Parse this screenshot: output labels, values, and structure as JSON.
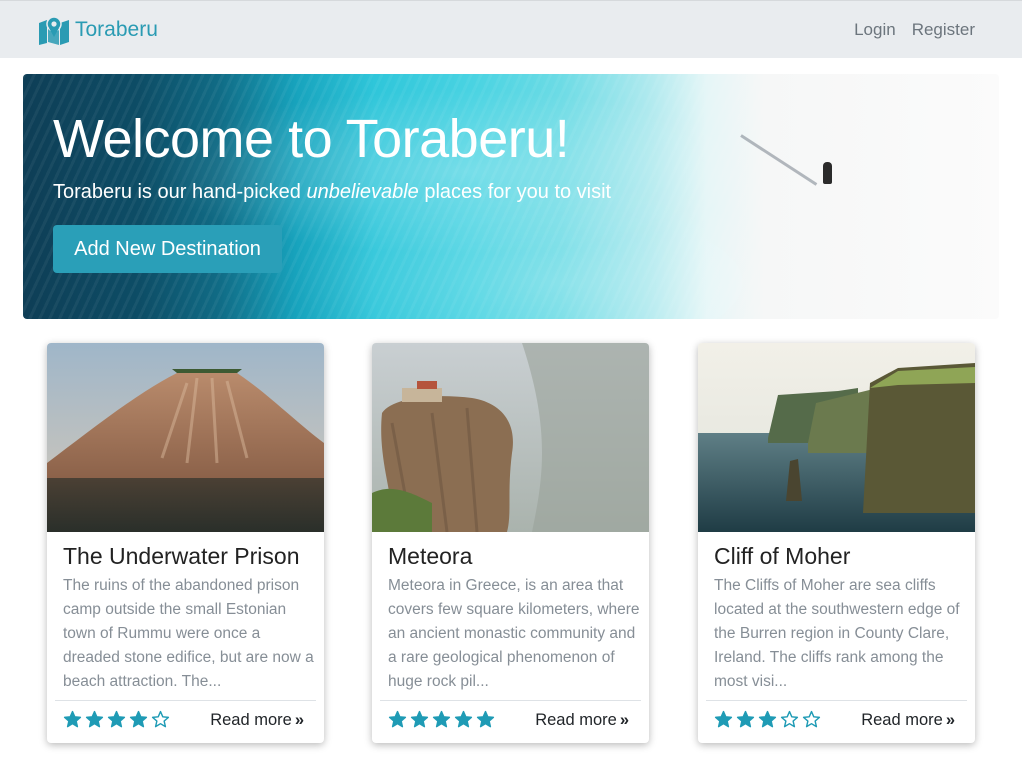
{
  "navbar": {
    "brand": "Toraberu",
    "brand_icon": "map-marker-icon",
    "links": [
      "Login",
      "Register"
    ]
  },
  "hero": {
    "title": "Welcome to Toraberu!",
    "lead_prefix": "Toraberu is our hand-picked ",
    "lead_emphasis": "unbelievable",
    "lead_suffix": " places for you to visit",
    "button": "Add New Destination"
  },
  "cards": [
    {
      "title": "The Underwater Prison",
      "text": "The ruins of the abandoned prison camp outside the small Estonian town of Rummu were once a dreaded stone edifice, but are now a beach attraction. The...",
      "rating": 4,
      "read_more": "Read more"
    },
    {
      "title": "Meteora",
      "text": "Meteora in Greece, is an area that covers few square kilometers, where an ancient monastic community and a rare geological phenomenon of huge rock pil...",
      "rating": 5,
      "read_more": "Read more"
    },
    {
      "title": "Cliff of Moher",
      "text": "The Cliffs of Moher are sea cliffs located at the southwestern edge of the Burren region in County Clare, Ireland. The cliffs rank among the most visi...",
      "rating": 3,
      "read_more": "Read more"
    }
  ],
  "colors": {
    "accent": "#2a9fb8",
    "star": "#1f9bb5",
    "navbar_bg": "#e9ecef"
  }
}
